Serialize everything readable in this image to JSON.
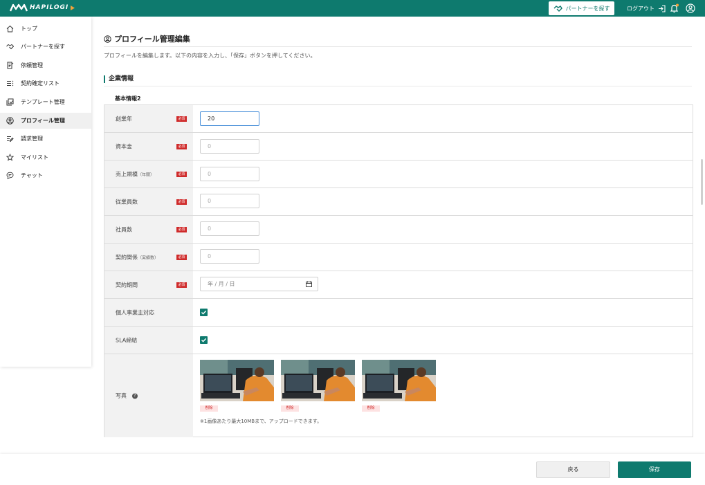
{
  "header": {
    "logo_text": "HAPILOGI",
    "partner_button": "パートナーを探す",
    "logout": "ログアウト"
  },
  "sidebar": {
    "items": [
      {
        "label": "トップ",
        "icon": "home-icon"
      },
      {
        "label": "パートナーを探す",
        "icon": "handshake-icon"
      },
      {
        "label": "依頼管理",
        "icon": "request-icon"
      },
      {
        "label": "契約確定リスト",
        "icon": "list-icon"
      },
      {
        "label": "テンプレート管理",
        "icon": "template-icon"
      },
      {
        "label": "プロフィール管理",
        "icon": "profile-icon",
        "active": true
      },
      {
        "label": "請求管理",
        "icon": "invoice-icon"
      },
      {
        "label": "マイリスト",
        "icon": "star-icon"
      },
      {
        "label": "チャット",
        "icon": "chat-icon"
      }
    ]
  },
  "page": {
    "title": "プロフィール管理編集",
    "description": "プロフィールを編集します。以下の内容を入力し、「保存」ボタンを押してください。",
    "section": "企業情報",
    "subheading": "基本情報2"
  },
  "form": {
    "required_label": "必須",
    "rows": [
      {
        "label": "創業年",
        "value": "20"
      },
      {
        "label": "資本金",
        "placeholder": "0"
      },
      {
        "label": "売上規模",
        "suffix": "（年間）",
        "placeholder": "0"
      },
      {
        "label": "従業員数",
        "placeholder": "0"
      },
      {
        "label": "社員数",
        "placeholder": "0"
      },
      {
        "label": "契約関係",
        "suffix": "（実績数）",
        "placeholder": "0"
      },
      {
        "label": "契約期間",
        "placeholder": "年 / 月 / 日"
      },
      {
        "label": "個人事業主対応",
        "checked": true
      },
      {
        "label": "SLA締結",
        "checked": true
      },
      {
        "label": "写真"
      }
    ],
    "help_mark": "?",
    "delete_label": "削除",
    "photo_note": "※1画像あたり最大10MBまで、アップロードできます。"
  },
  "footer": {
    "back": "戻る",
    "save": "保存"
  },
  "colors": {
    "brand": "#0e7a6e",
    "required": "#cf2a2a"
  }
}
